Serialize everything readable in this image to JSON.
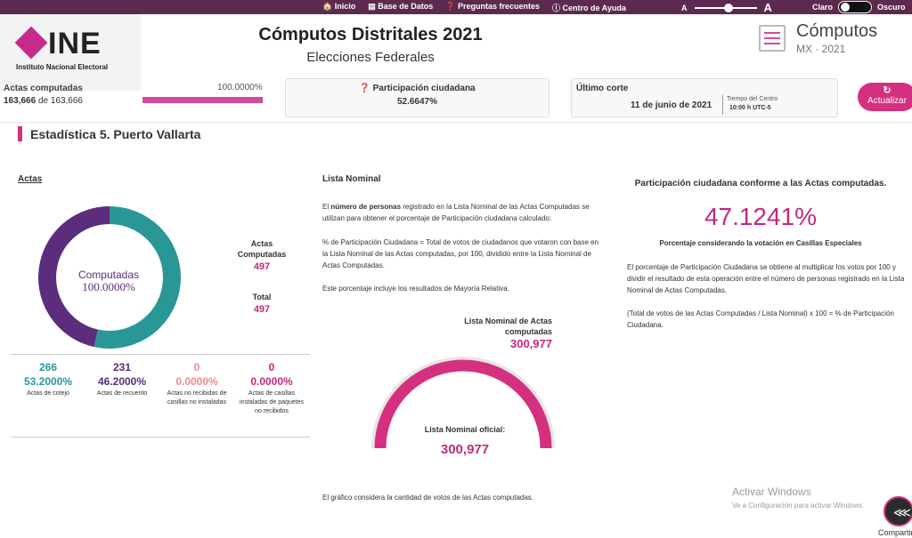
{
  "topbar": {
    "nav": [
      "🏠 Inicio",
      "▤ Base de Datos",
      "❓ Preguntas frecuentes",
      "ⓘ Centro de Ayuda"
    ],
    "zoom_small": "A",
    "zoom_large": "A",
    "theme_light": "Claro",
    "theme_dark": "Oscuro"
  },
  "header": {
    "logo_text": "INE",
    "logo_subtitle": "Instituto Nacional Electoral",
    "title": "Cómputos Distritales 2021",
    "subtitle": "Elecciones Federales",
    "brand_title": "Cómputos",
    "brand_sub": "MX · 2021"
  },
  "summary": {
    "actas_label": "Actas computadas",
    "actas_pct": "100.0000%",
    "actas_progress": 1.0,
    "actas_count": "163,666",
    "actas_of": "de",
    "actas_total": "163,666",
    "participacion_label": "❓ Participación ciudadana",
    "participacion_value": "52.6647%",
    "corte_label": "Último corte",
    "corte_date": "11 de junio de 2021",
    "corte_tz_label": "Tiempo del Centro",
    "corte_time": "10:00 h UTC-5",
    "refresh_icon": "↻",
    "refresh_label": "Actualizar"
  },
  "section": {
    "title": "Estadística 5. Puerto Vallarta"
  },
  "actas": {
    "heading": "Actas",
    "donut_label": "Computadas",
    "donut_value": "100.0000%",
    "donut_split": [
      231,
      266
    ],
    "colors": {
      "teal": "#2a9797",
      "purple": "#5b2d7c",
      "pink": "#c2287f",
      "salmon": "#f08a8a"
    },
    "computadas_label": "Actas Computadas",
    "computadas_value": "497",
    "total_label": "Total",
    "total_value": "497",
    "stats": [
      {
        "n": "266",
        "p": "53.2000%",
        "d": "Actas de cotejo"
      },
      {
        "n": "231",
        "p": "46.2000%",
        "d": "Actas de recuento"
      },
      {
        "n": "0",
        "p": "0.0000%",
        "d": "Actas no recibidas de casillas no instaladas"
      },
      {
        "n": "0",
        "p": "0.0000%",
        "d": "Actas de casillas instaladas de paquetes no recibidos"
      }
    ]
  },
  "lista": {
    "heading": "Lista Nominal",
    "p1_a": "El ",
    "p1_b": "número de personas",
    "p1_c": " registrado en la Lista Nominal de las Actas Computadas se utilizan para obtener el porcentaje de Participación ciudadana calculado:",
    "p2": "% de Participación Ciudadana = Total de votos de ciudadanos que votaron con base en la Lista Nominal de las Actas computadas, por 100, dividido entre la Lista Nominal de Actas Computadas.",
    "p3": "Este porcentaje incluye los resultados de Mayoría Relativa.",
    "computadas_label": "Lista Nominal de Actas computadas",
    "computadas_value": "300,977",
    "oficial_label": "Lista Nominal oficial:",
    "oficial_value": "300,977",
    "footnote": "El gráfico considera la cantidad de votos de las Actas computadas."
  },
  "participacion": {
    "heading": "Participación ciudadana conforme a las Actas computadas.",
    "value": "47.1241%",
    "sub": "Porcentaje considerando la votación en Casillas Especiales",
    "p1": "El porcentaje de Participación Ciudadana se obtiene al multiplicar los votos por 100 y dividir el resultado de esta operación entre el número de personas registrado en la Lista Nominal de Actas Computadas.",
    "p2": "(Total de votos de las Actas Computadas / Lista Nominal) x 100 = % de Participación Ciudadana."
  },
  "watermark": {
    "line1": "Activar Windows",
    "line2": "Ve a Configuración para activar Windows."
  },
  "share": {
    "icon": "⋘",
    "label": "Compartir"
  }
}
